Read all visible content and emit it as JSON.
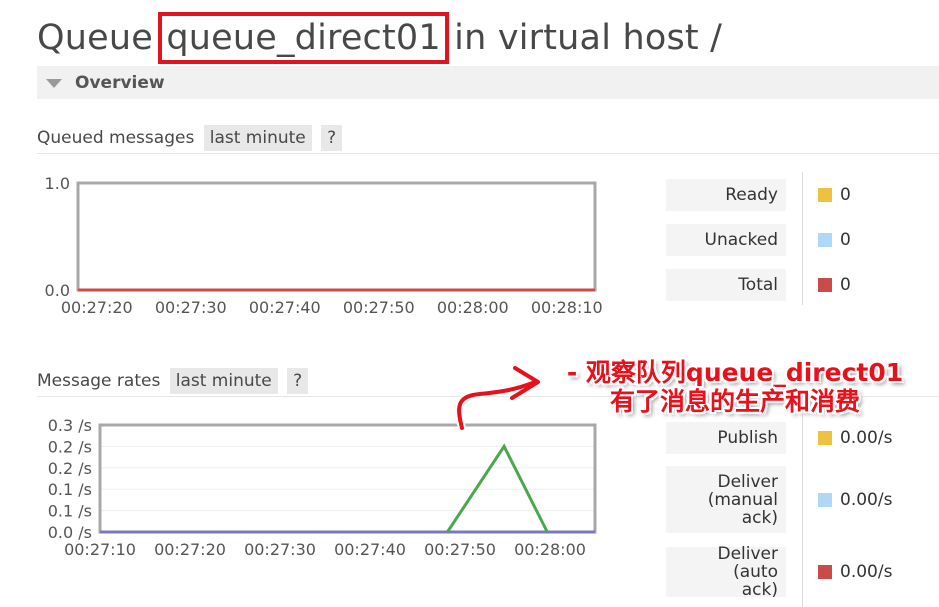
{
  "header": {
    "title_prefix": "Queue ",
    "queue_name": "queue_direct01",
    "title_suffix": " in virtual host /"
  },
  "overview": {
    "label": "Overview"
  },
  "queued": {
    "label": "Queued messages",
    "range": "last minute",
    "help": "?",
    "legend": [
      {
        "label": "Ready",
        "value": "0",
        "color": "#edc240"
      },
      {
        "label": "Unacked",
        "value": "0",
        "color": "#afd8f8"
      },
      {
        "label": "Total",
        "value": "0",
        "color": "#cb4b4b"
      }
    ]
  },
  "rates": {
    "label": "Message rates",
    "range": "last minute",
    "help": "?",
    "legend": [
      {
        "label": "Publish",
        "value": "0.00/s",
        "color": "#edc240"
      },
      {
        "label": "Deliver (manual ack)",
        "value": "0.00/s",
        "color": "#afd8f8"
      },
      {
        "label": "Deliver (auto ack)",
        "value": "0.00/s",
        "color": "#cb4b4b"
      }
    ]
  },
  "annotation": {
    "line1": "- 观察队列queue_direct01",
    "line2": "有了消息的生产和消费",
    "color": "#e8101a"
  },
  "chart_data": [
    {
      "type": "line",
      "ylim": [
        0,
        1
      ],
      "yticks": [
        "1.0",
        "0.0"
      ],
      "xticks": [
        "00:27:20",
        "00:27:30",
        "00:27:40",
        "00:27:50",
        "00:28:00",
        "00:28:10"
      ],
      "xrange": [
        "00:27:18",
        "00:28:13"
      ],
      "series": [
        {
          "color": "#cb4b4b",
          "points": [
            [
              "00:27:18",
              0
            ],
            [
              "00:28:13",
              0
            ]
          ]
        }
      ]
    },
    {
      "type": "line",
      "ylim": [
        0,
        0.25
      ],
      "yticks": [
        "0.0 /s",
        "0.1 /s",
        "0.1 /s",
        "0.2 /s",
        "0.2 /s",
        "0.3 /s"
      ],
      "xticks": [
        "00:27:10",
        "00:27:20",
        "00:27:30",
        "00:27:40",
        "00:27:50",
        "00:28:00"
      ],
      "xrange": [
        "00:27:10",
        "00:28:05"
      ],
      "series": [
        {
          "color": "#7a78c0",
          "points": [
            [
              "00:27:10",
              0
            ],
            [
              "00:28:05",
              0
            ]
          ]
        },
        {
          "color": "#4da74d",
          "points": [
            [
              "00:27:48.6",
              0
            ],
            [
              "00:27:54.9",
              0.2
            ],
            [
              "00:27:59.7",
              0
            ]
          ]
        }
      ]
    }
  ]
}
